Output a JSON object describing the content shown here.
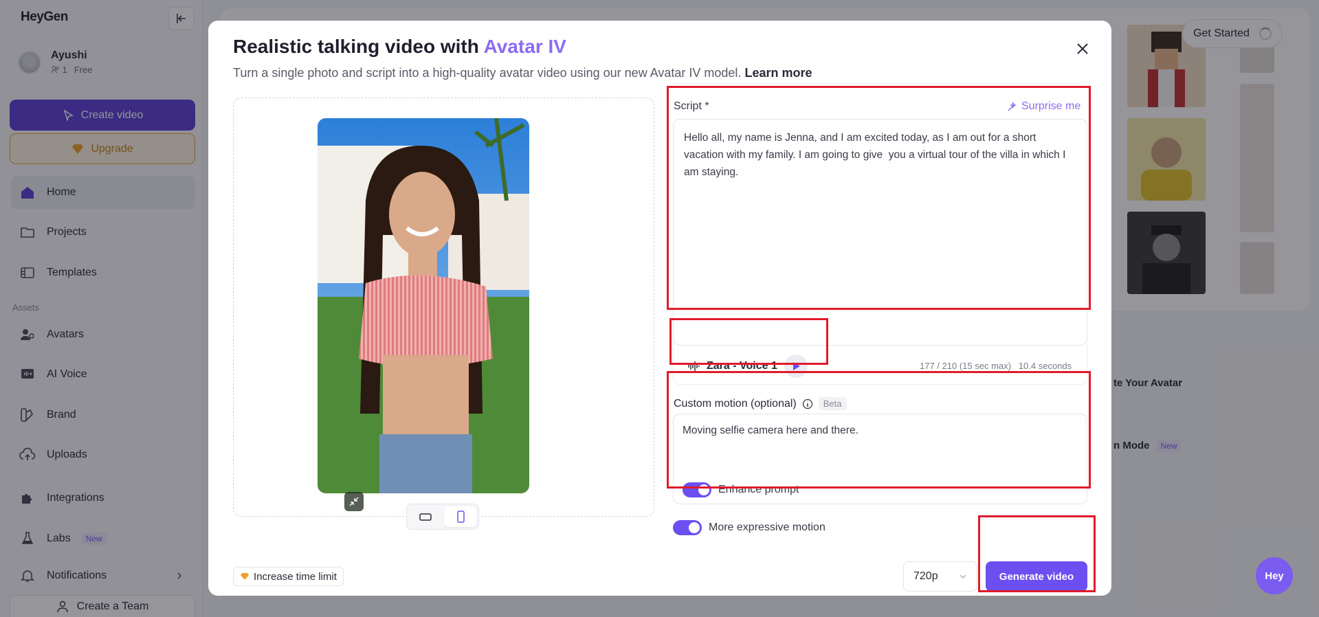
{
  "sidebar": {
    "logo": "HeyGen",
    "user": {
      "name": "Ayushi",
      "members": "1",
      "plan": "Free"
    },
    "create_label": "Create video",
    "upgrade_label": "Upgrade",
    "nav": [
      {
        "label": "Home",
        "icon": "home-icon"
      },
      {
        "label": "Projects",
        "icon": "folder-icon"
      },
      {
        "label": "Templates",
        "icon": "templates-icon"
      }
    ],
    "assets_label": "Assets",
    "assets": [
      {
        "label": "Avatars",
        "icon": "avatar-icon"
      },
      {
        "label": "AI Voice",
        "icon": "voice-icon"
      },
      {
        "label": "Brand",
        "icon": "brand-icon"
      },
      {
        "label": "Uploads",
        "icon": "upload-icon"
      },
      {
        "label": "Integrations",
        "icon": "puzzle-icon"
      },
      {
        "label": "Labs",
        "icon": "flask-icon",
        "badge": "New"
      },
      {
        "label": "Notifications",
        "icon": "bell-icon"
      }
    ],
    "team_label": "Create a Team"
  },
  "background": {
    "get_started": "Get Started",
    "create_avatar_text": "te Your Avatar",
    "mode_text": "n Mode",
    "mode_badge": "New"
  },
  "modal": {
    "title_prefix": "Realistic talking video with ",
    "title_accent": "Avatar IV",
    "subtitle": "Turn a single photo and script into a high-quality avatar video using our new Avatar IV model.",
    "learn_more": "Learn more",
    "script_label": "Script *",
    "surprise_label": "Surprise me",
    "script_text": "Hello all, my name is Jenna, and I am excited today, as I am out for a short vacation with my family. I am going to give  you a virtual tour of the villa in which I am staying.",
    "voice_name": "Zara - Voice 1",
    "char_count": "177 / 210 (15 sec max)",
    "duration": "10.4 seconds",
    "motion_label": "Custom motion (optional)",
    "motion_badge": "Beta",
    "motion_text": "Moving selfie camera here and there.",
    "enhance_label": "Enhance prompt",
    "enhance_on": true,
    "expressive_label": "More expressive motion",
    "expressive_on": true,
    "time_limit_label": "Increase time limit",
    "resolution": "720p",
    "generate_label": "Generate video",
    "orientation_selected": "portrait"
  },
  "chat_bubble": "Hey",
  "colors": {
    "accent": "#6c4ff0",
    "highlight": "#e01b2b",
    "create_button": "#5b3fd6",
    "upgrade": "#e7a33a"
  }
}
